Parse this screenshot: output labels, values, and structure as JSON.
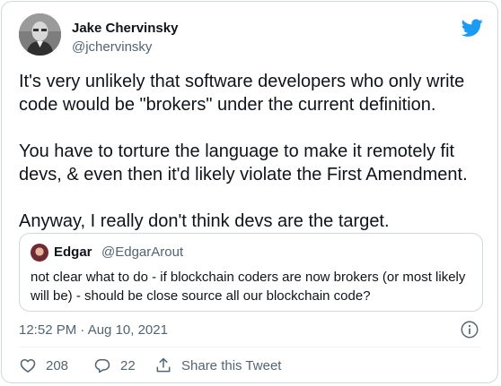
{
  "author": {
    "name": "Jake Chervinsky",
    "handle": "@jchervinsky"
  },
  "brand_icon": "twitter-bird-icon",
  "brand_color": "#1d9bf0",
  "tweet": {
    "text": "It's very unlikely that software developers who only write code would be \"brokers\" under the current definition.\n\nYou have to torture the language to make it remotely fit devs, & even then it'd likely violate the First Amendment.\n\nAnyway, I really don't think devs are the target."
  },
  "quoted_tweet": {
    "name": "Edgar",
    "handle": "@EdgarArout",
    "text": "not clear what to do - if blockchain coders are now brokers (or most likely will be) - should be close source all our blockchain code?"
  },
  "timestamp": "12:52 PM · Aug 10, 2021",
  "actions": {
    "likes": "208",
    "replies": "22",
    "share_label": "Share this Tweet"
  },
  "icons": [
    "heart-icon",
    "reply-icon",
    "share-icon",
    "info-icon"
  ]
}
